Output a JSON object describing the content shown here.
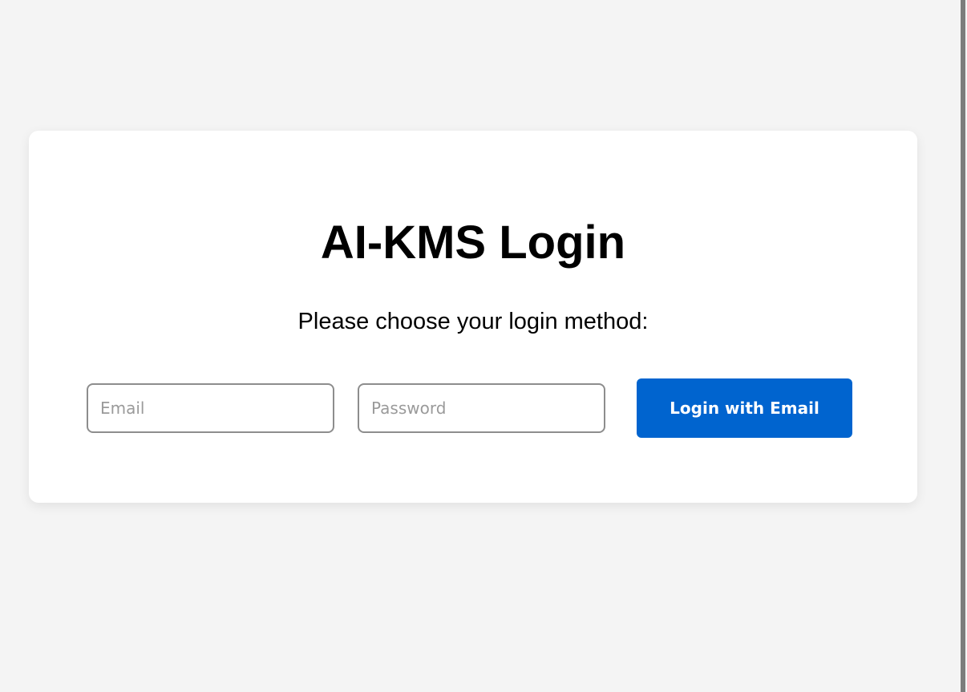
{
  "login": {
    "title": "AI-KMS Login",
    "subtitle": "Please choose your login method:",
    "email_placeholder": "Email",
    "email_value": "",
    "password_placeholder": "Password",
    "password_value": "",
    "submit_label": "Login with Email"
  },
  "colors": {
    "page_background": "#f4f4f4",
    "card_background": "#ffffff",
    "button_background": "#0064cf",
    "button_text": "#ffffff",
    "input_border": "#8d8d8d"
  }
}
